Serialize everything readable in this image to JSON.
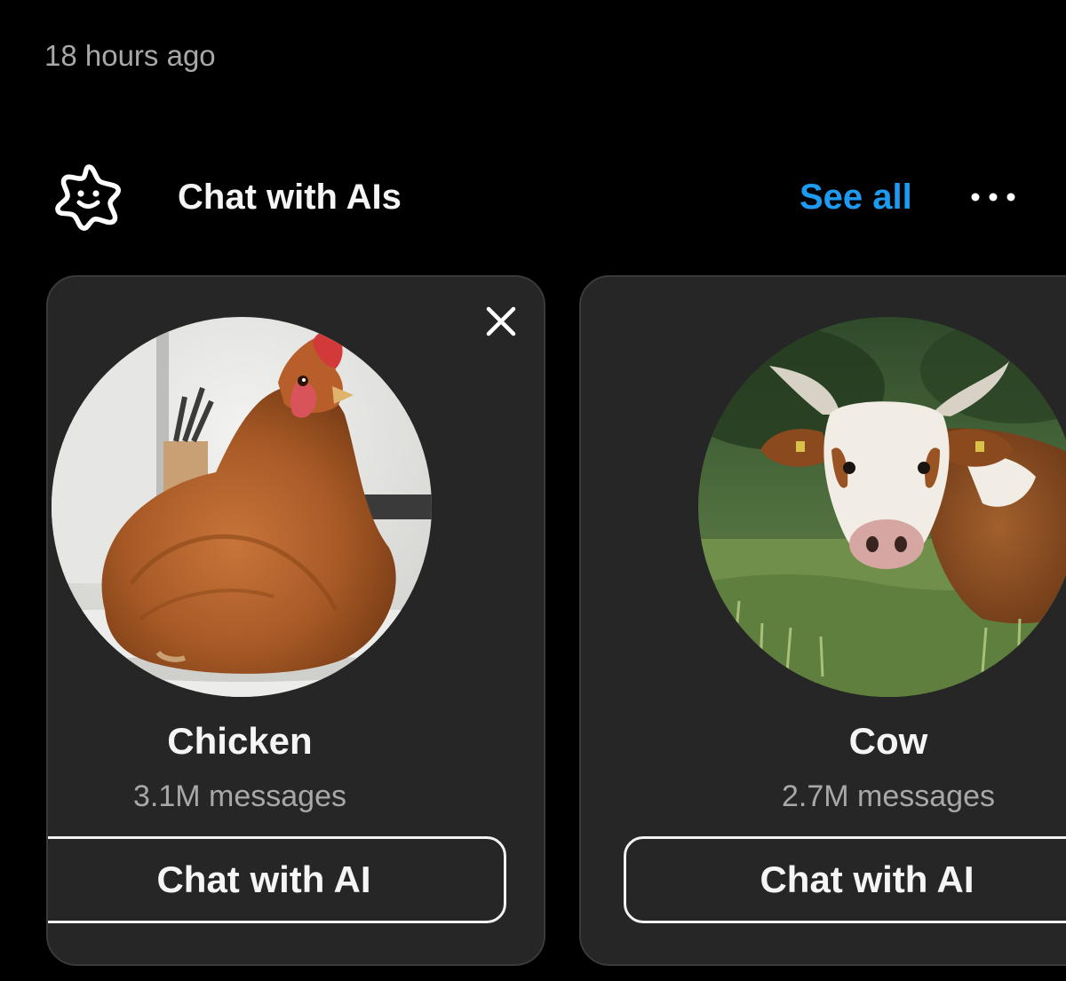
{
  "timestamp": "18 hours ago",
  "section": {
    "icon": "ai-sparkle-face-icon",
    "title": "Chat with AIs",
    "see_all": "See all",
    "more_icon": "more-horizontal-icon"
  },
  "colors": {
    "background": "#000000",
    "card": "#262626",
    "accent": "#1d9bf0",
    "muted_text": "#a8a8a8"
  },
  "cards": [
    {
      "name": "Chicken",
      "messages": "3.1M messages",
      "button": "Chat with AI",
      "avatar_icon": "chicken-photo",
      "close_icon": "close-icon"
    },
    {
      "name": "Cow",
      "messages": "2.7M messages",
      "button": "Chat with AI",
      "avatar_icon": "cow-photo"
    }
  ]
}
